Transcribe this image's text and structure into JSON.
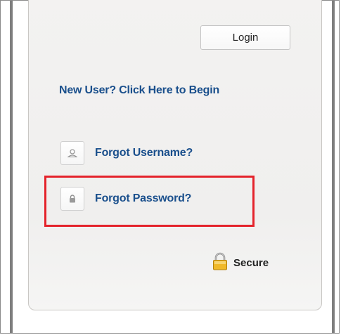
{
  "login_button": {
    "label": "Login"
  },
  "new_user_link": {
    "label": "New User? Click Here to Begin"
  },
  "forgot_username": {
    "label": "Forgot Username?",
    "icon": "user-icon"
  },
  "forgot_password": {
    "label": "Forgot Password?",
    "icon": "lock-icon",
    "highlight_color": "#e4232b"
  },
  "secure": {
    "label": "Secure",
    "icon": "padlock-icon"
  },
  "colors": {
    "link": "#1a4f8c",
    "panel": "#f2f1f0"
  }
}
